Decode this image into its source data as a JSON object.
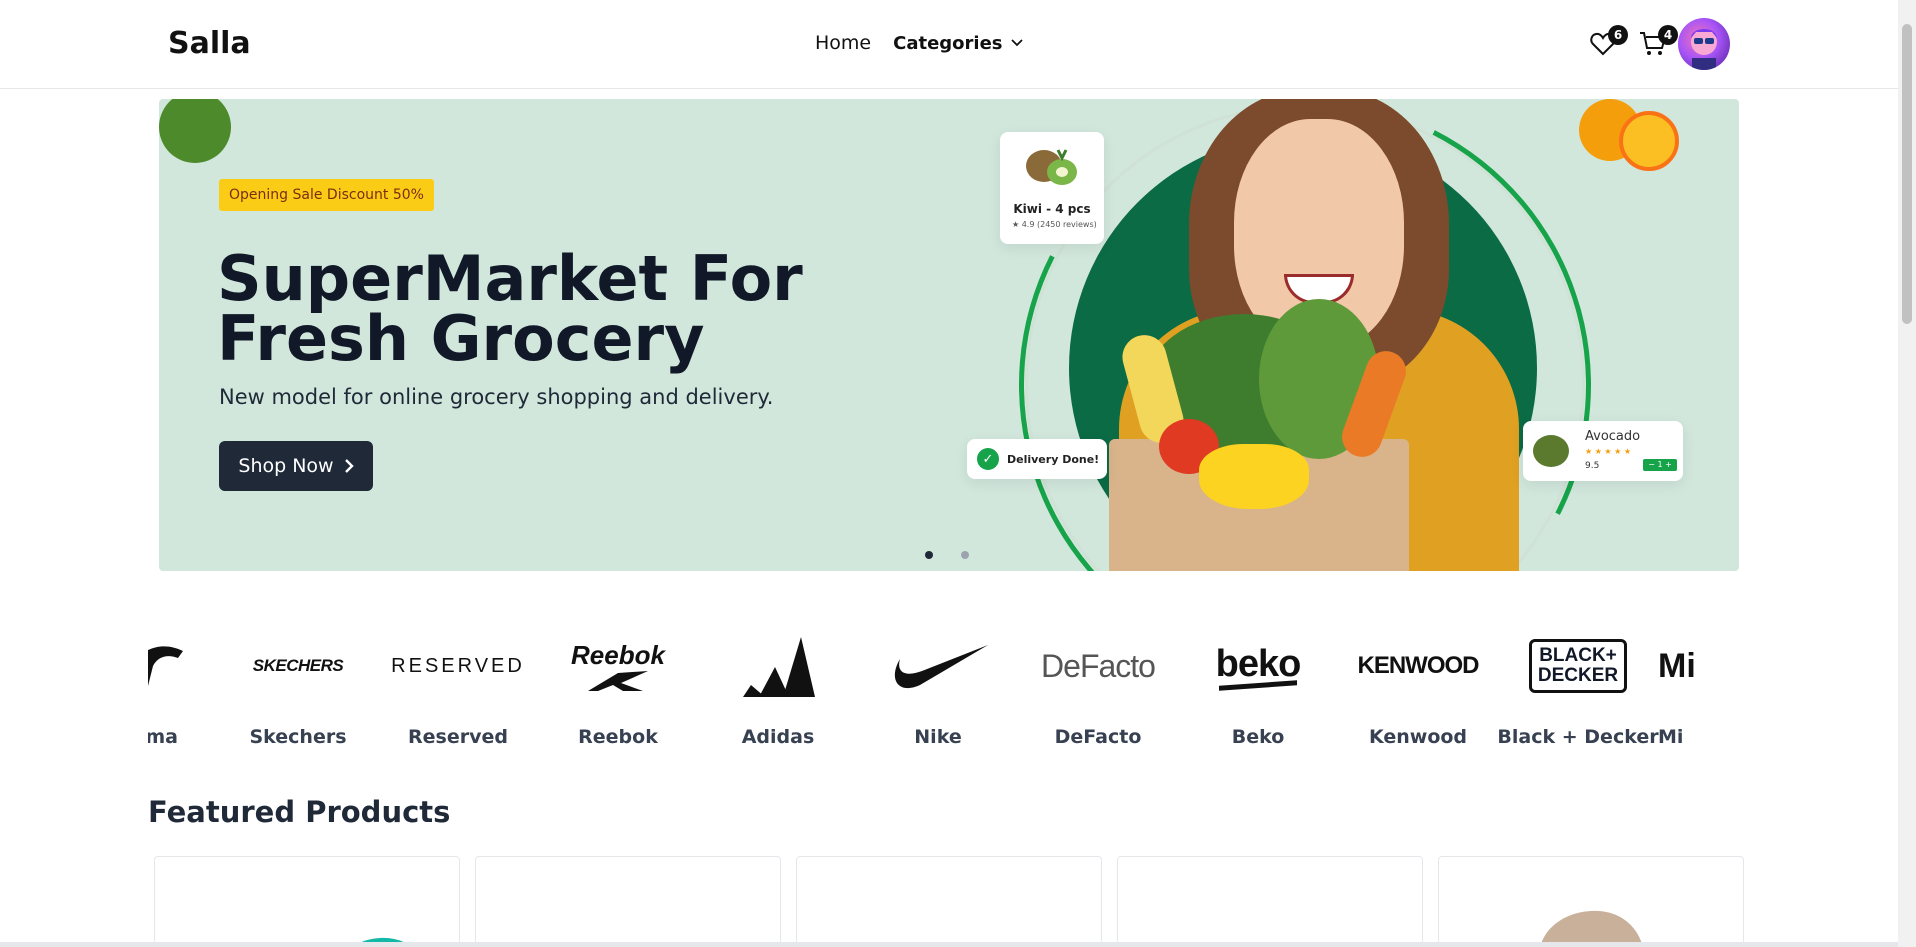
{
  "header": {
    "logo": "Salla",
    "nav": {
      "home": "Home",
      "categories": "Categories"
    },
    "wishlist_count": "6",
    "cart_count": "4"
  },
  "hero": {
    "promo": "Opening Sale Discount 50%",
    "title": "SuperMarket For Fresh Grocery",
    "subtitle": "New model for online grocery shopping and delivery.",
    "cta": "Shop Now",
    "cards": {
      "kiwi_name": "Kiwi - 4 pcs",
      "kiwi_rating": "★ 4.9 (2450 reviews)",
      "delivery": "Delivery Done!",
      "avocado_name": "Avocado",
      "avocado_stars": "★ ★ ★ ★ ★",
      "avocado_price": "9.5",
      "avocado_qty": "− 1 +"
    },
    "slides": 2,
    "active_slide": 1
  },
  "brands": [
    {
      "name": "Puma",
      "display": "ma"
    },
    {
      "name": "Skechers",
      "display": "Skechers"
    },
    {
      "name": "Reserved",
      "display": "Reserved"
    },
    {
      "name": "Reebok",
      "display": "Reebok"
    },
    {
      "name": "Adidas",
      "display": "Adidas"
    },
    {
      "name": "Nike",
      "display": "Nike"
    },
    {
      "name": "DeFacto",
      "display": "DeFacto"
    },
    {
      "name": "Beko",
      "display": "Beko"
    },
    {
      "name": "Kenwood",
      "display": "Kenwood"
    },
    {
      "name": "Black + Decker",
      "display": "Black + Decker"
    },
    {
      "name": "Mi",
      "display": "Mi"
    }
  ],
  "brand_logos": {
    "skechers": "SKECHERS",
    "reserved": "RESERVED",
    "reebok": "Reebok",
    "defacto": "DeFacto",
    "beko": "beko",
    "kenwood": "KENWOOD",
    "black_decker_1": "BLACK+",
    "black_decker_2": "DECKER",
    "mi": "Mi"
  },
  "featured": {
    "title": "Featured Products"
  },
  "colors": {
    "hero_bg": "#d1e7dc",
    "accent_green": "#16a34a",
    "dark": "#1f2937",
    "promo_yellow": "#facc15"
  }
}
